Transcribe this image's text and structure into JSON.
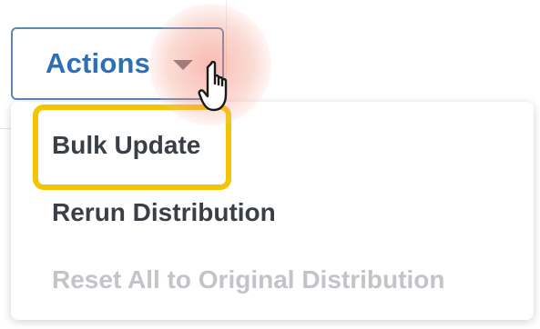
{
  "actions_button": {
    "label": "Actions",
    "icon": "caret-down-icon"
  },
  "menu": {
    "items": [
      {
        "label": "Bulk Update",
        "state": "highlighted"
      },
      {
        "label": "Rerun Distribution",
        "state": "enabled"
      },
      {
        "label": "Reset All to Original Distribution",
        "state": "disabled"
      }
    ]
  },
  "colors": {
    "accent": "#2c6fb3",
    "button_border": "#5b86b9",
    "highlight": "#f4c400",
    "menu_text": "#3a3f45",
    "disabled_text": "#c2c4c7",
    "click_halo": "#f07864"
  },
  "cursor": {
    "icon": "hand-pointer-icon"
  }
}
